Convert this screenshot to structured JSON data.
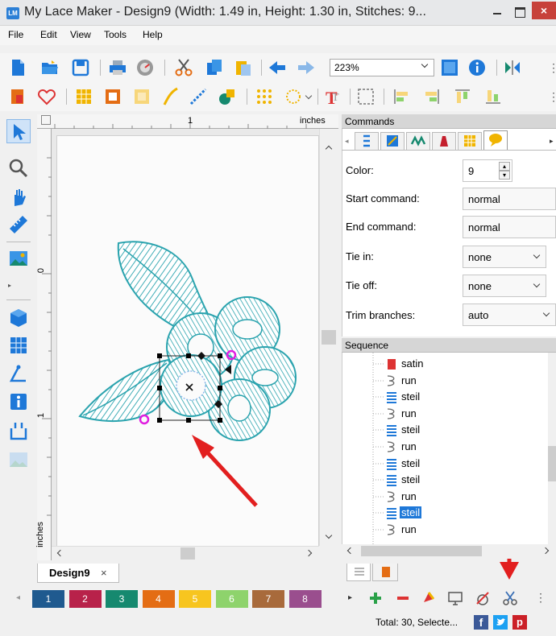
{
  "window": {
    "title": "My Lace Maker - Design9 (Width: 1.49 in, Height: 1.30 in, Stitches: 9...",
    "app_icon_text": "LM"
  },
  "menu": [
    "File",
    "Edit",
    "View",
    "Tools",
    "Help"
  ],
  "toolbar": {
    "zoom_value": "223%"
  },
  "rulers": {
    "top_tick": "1",
    "units_top": "inches",
    "left_tick_0": "0",
    "left_tick_1": "1",
    "units_left": "inches"
  },
  "document_tab": {
    "label": "Design9",
    "close": "×"
  },
  "commands": {
    "header": "Commands",
    "properties": [
      {
        "label": "Color:",
        "value": "9"
      },
      {
        "label": "Start command:",
        "value": "normal"
      },
      {
        "label": "End command:",
        "value": "normal"
      },
      {
        "label": "Tie in:",
        "value": "none"
      },
      {
        "label": "Tie off:",
        "value": "none"
      },
      {
        "label": "Trim branches:",
        "value": "auto"
      }
    ]
  },
  "sequence": {
    "header": "Sequence",
    "items": [
      "satin",
      "run",
      "steil",
      "run",
      "steil",
      "run",
      "steil",
      "steil",
      "run",
      "steil",
      "run"
    ],
    "selected_index": 9
  },
  "palette": [
    {
      "label": "1",
      "color": "#1f5a8f"
    },
    {
      "label": "2",
      "color": "#b8224a"
    },
    {
      "label": "3",
      "color": "#16896f"
    },
    {
      "label": "4",
      "color": "#e46d14"
    },
    {
      "label": "5",
      "color": "#f7c51f"
    },
    {
      "label": "6",
      "color": "#8ed36c"
    },
    {
      "label": "7",
      "color": "#a86a3b"
    },
    {
      "label": "8",
      "color": "#9a4e8e"
    }
  ],
  "status": {
    "text": "Total: 30, Selecte..."
  },
  "colors": {
    "accent": "#1e78d8",
    "lace": "#2aa3ae",
    "arrow": "#e21f1f"
  }
}
